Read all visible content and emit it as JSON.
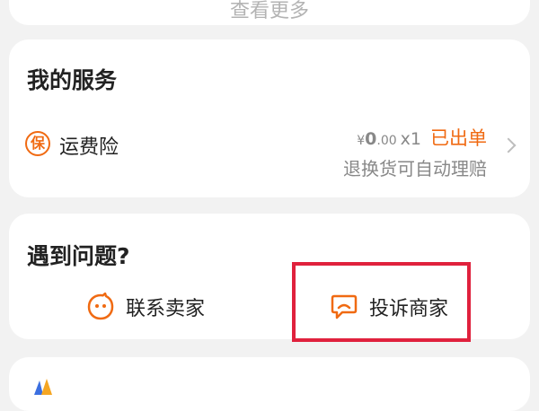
{
  "top_card": {
    "more_label": "查看更多"
  },
  "services": {
    "title": "我的服务",
    "item": {
      "icon_glyph": "保",
      "name": "运费险",
      "currency": "¥",
      "amount_int": "0",
      "amount_dec": ".00",
      "quantity": "x1",
      "status": "已出单",
      "subtext": "退换货可自动理赔"
    }
  },
  "problem": {
    "title": "遇到问题?",
    "contact_label": "联系卖家",
    "complain_label": "投诉商家"
  },
  "colors": {
    "accent": "#f06a12",
    "highlight": "#e0213d",
    "background": "#f2f2f2"
  },
  "icons": [
    "bao-icon",
    "chevron-right-icon",
    "smiley-chat-icon",
    "complaint-chat-icon"
  ]
}
